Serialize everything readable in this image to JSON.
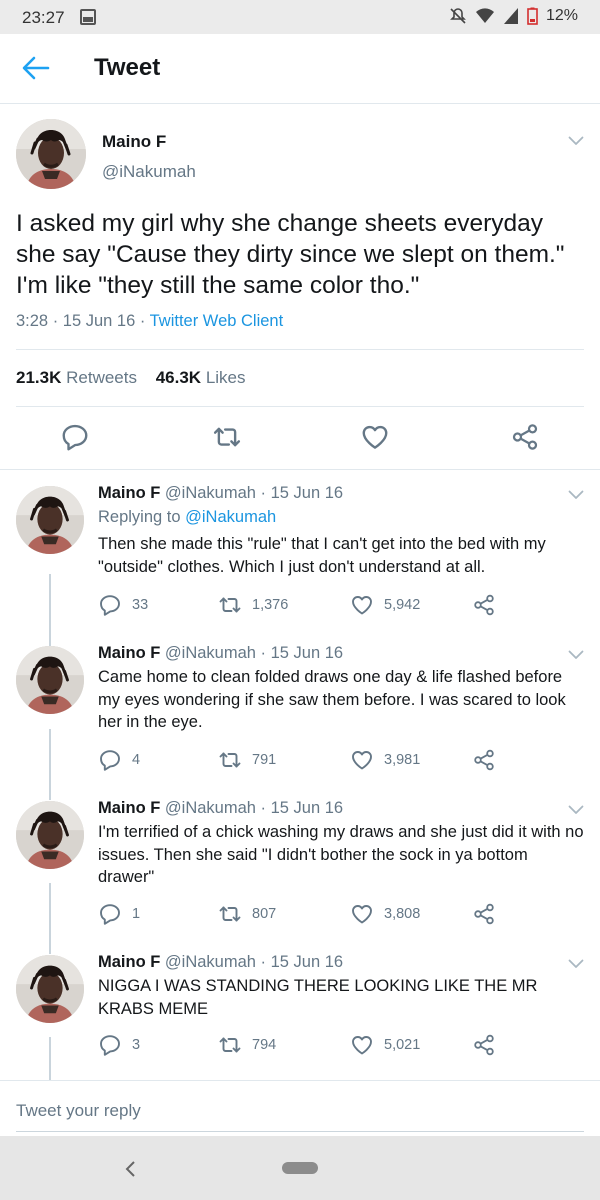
{
  "status_bar": {
    "time": "23:27",
    "battery": "12%"
  },
  "header": {
    "title": "Tweet"
  },
  "main_tweet": {
    "name": "Maino F",
    "handle": "@iNakumah",
    "text": "I asked my girl why she change sheets everyday she say \"Cause they dirty since we slept on them.\" I'm like \"they still the same color tho.\"",
    "meta": "3:28 · 15 Jun 16 · ",
    "client": "Twitter Web Client",
    "retweets_count": "21.3K",
    "retweets_label": "Retweets",
    "likes_count": "46.3K",
    "likes_label": "Likes"
  },
  "replies": [
    {
      "name": "Maino F",
      "handle_date": "@iNakumah · 15 Jun 16",
      "replying_prefix": "Replying to ",
      "replying_to": "@iNakumah",
      "text": "Then she made this \"rule\" that I can't get into the bed with my \"outside\" clothes. Which I just don't understand at all.",
      "replies": "33",
      "retweets": "1,376",
      "likes": "5,942"
    },
    {
      "name": "Maino F",
      "handle_date": "@iNakumah · 15 Jun 16",
      "text": "Came home to clean folded draws one day & life flashed before my eyes wondering if she saw them before. I was scared to look her in the eye.",
      "replies": "4",
      "retweets": "791",
      "likes": "3,981"
    },
    {
      "name": "Maino F",
      "handle_date": "@iNakumah · 15 Jun 16",
      "text": "I'm terrified of a chick washing my draws and she just did it with no issues. Then she said \"I didn't bother the sock in ya bottom drawer\"",
      "replies": "1",
      "retweets": "807",
      "likes": "3,808"
    },
    {
      "name": "Maino F",
      "handle_date": "@iNakumah · 15 Jun 16",
      "text": "NIGGA I WAS STANDING THERE LOOKING LIKE THE MR KRABS MEME",
      "replies": "3",
      "retweets": "794",
      "likes": "5,021"
    }
  ],
  "reply_box": {
    "placeholder": "Tweet your reply"
  },
  "colors": {
    "accent": "#1da1f2",
    "link": "#1b95e0",
    "secondary_text": "#657786",
    "icon_gray": "#657786"
  },
  "icons": [
    "back-arrow-icon",
    "reply-icon",
    "retweet-icon",
    "like-icon",
    "share-icon",
    "chevron-down-icon"
  ]
}
